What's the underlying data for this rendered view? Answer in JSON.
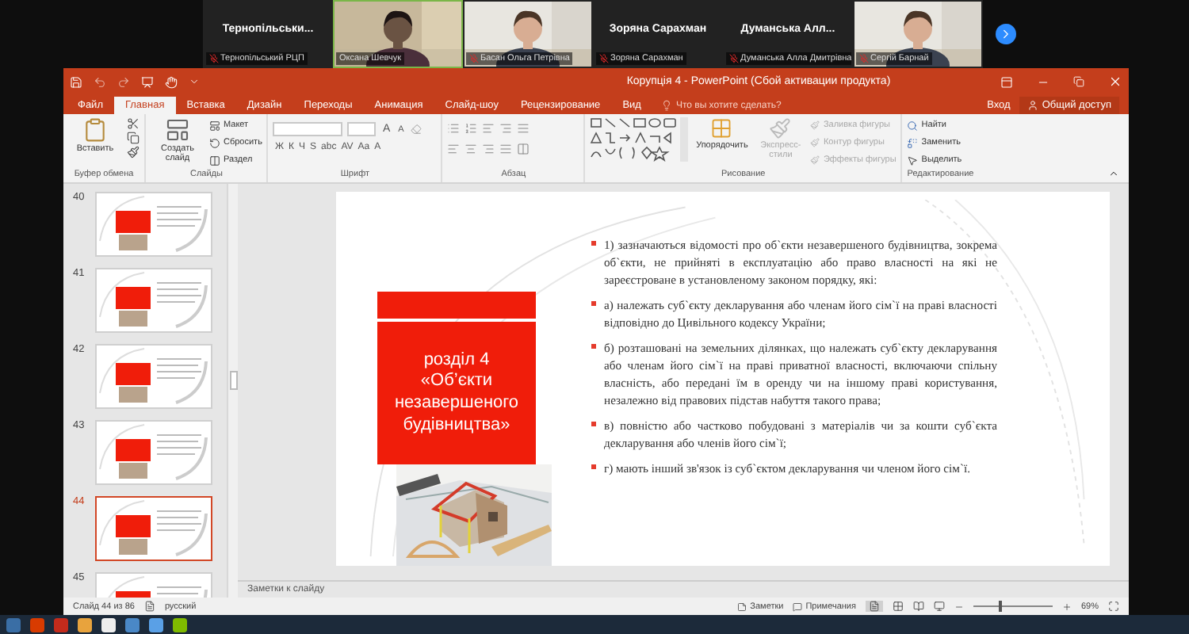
{
  "participants": [
    {
      "name": "Тернопільськи...",
      "label": "Тернопільський РЦП",
      "video": false,
      "muted": true,
      "speaking": false
    },
    {
      "label": "Оксана Шевчук",
      "video": true,
      "muted": false,
      "speaking": true
    },
    {
      "label": "Басан Ольга Петрівна",
      "video": true,
      "muted": true,
      "speaking": false
    },
    {
      "name": "Зоряна Сарахман",
      "label": "Зоряна Сарахман",
      "video": false,
      "muted": true,
      "speaking": false
    },
    {
      "name": "Думанська  Алл...",
      "label": "Думанська Алла Дмитрівна",
      "video": false,
      "muted": true,
      "speaking": false
    },
    {
      "label": "Сергій Барнай",
      "video": true,
      "muted": true,
      "speaking": false
    }
  ],
  "presentation": {
    "title": "Корупція 4 - PowerPoint (Сбой активации продукта)",
    "tabs": [
      {
        "label": "Файл",
        "selected": false
      },
      {
        "label": "Главная",
        "selected": true
      },
      {
        "label": "Вставка",
        "selected": false
      },
      {
        "label": "Дизайн",
        "selected": false
      },
      {
        "label": "Переходы",
        "selected": false
      },
      {
        "label": "Анимация",
        "selected": false
      },
      {
        "label": "Слайд-шоу",
        "selected": false
      },
      {
        "label": "Рецензирование",
        "selected": false
      },
      {
        "label": "Вид",
        "selected": false
      }
    ],
    "tell_me": "Что вы хотите сделать?",
    "sign_in": "Вход",
    "share": "Общий доступ",
    "ribbon": {
      "clipboard": {
        "label": "Буфер обмена",
        "paste": "Вставить"
      },
      "slides": {
        "label": "Слайды",
        "new_slide": "Создать слайд",
        "items": [
          "Макет",
          "Сбросить",
          "Раздел"
        ]
      },
      "font": {
        "label": "Шрифт",
        "size_buttons": [
          "A",
          "A"
        ],
        "format_buttons": [
          "Ж",
          "К",
          "Ч",
          "S",
          "abc",
          "AV",
          "Aa",
          "A"
        ]
      },
      "paragraph": {
        "label": "Абзац"
      },
      "drawing": {
        "label": "Рисование",
        "arrange": {
          "label": "Упорядочить",
          "disabled": false
        },
        "quick_styles": {
          "label": "Экспресс-стили",
          "disabled": true
        },
        "items": [
          {
            "label": "Заливка фигуры",
            "disabled": true
          },
          {
            "label": "Контур фигуры",
            "disabled": true
          },
          {
            "label": "Эффекты фигуры",
            "disabled": true
          }
        ]
      },
      "editing": {
        "label": "Редактирование",
        "items": [
          "Найти",
          "Заменить",
          "Выделить"
        ]
      }
    },
    "thumbnails": [
      {
        "number": "40",
        "selected": false
      },
      {
        "number": "41",
        "selected": false
      },
      {
        "number": "42",
        "selected": false
      },
      {
        "number": "43",
        "selected": false
      },
      {
        "number": "44",
        "selected": true
      },
      {
        "number": "45",
        "selected": false
      }
    ],
    "slide": {
      "title": "розділ 4 «Об’єкти незавершеного будівництва»",
      "bullets": [
        "1) зазначаються відомості про об`єкти незавершеного будівництва, зокрема об`єкти, не прийняті в експлуатацію або право власності на які не зареєстроване в установленому законом порядку, які:",
        "а) належать суб`єкту декларування або членам його сім`ї на праві власності відповідно до Цивільного кодексу України;",
        "б) розташовані на земельних ділянках, що належать суб`єкту декларування або членам його сім`ї на праві приватної власності, включаючи спільну власність, або передані їм в оренду чи на іншому праві користування, незалежно від правових підстав набуття такого права;",
        "в) повністю або частково побудовані з матеріалів чи за кошти суб`єкта декларування або членів його сім`ї;",
        "г) мають інший зв'язок із суб`єктом декларування чи членом його сім`ї."
      ]
    },
    "notes_placeholder": "Заметки к слайду",
    "status": {
      "slide": "Слайд 44 из 86",
      "language": "русский",
      "notes": "Заметки",
      "comments": "Примечания",
      "zoom": "69%",
      "zoom_level": {
        "level": 0.33
      }
    }
  }
}
